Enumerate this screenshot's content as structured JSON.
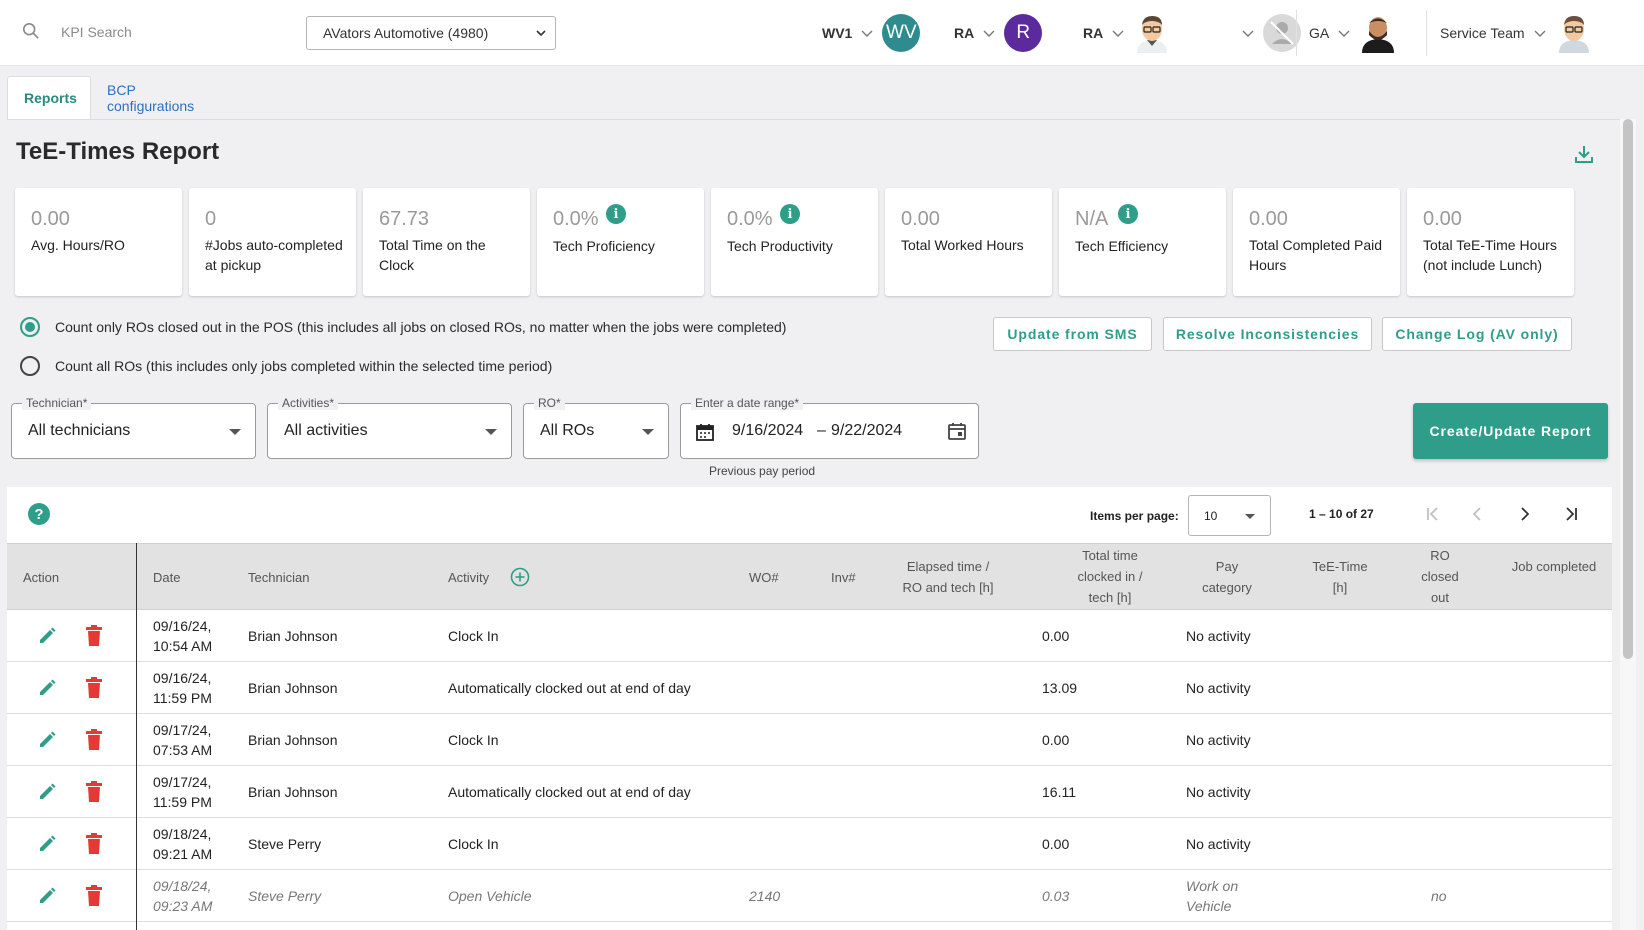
{
  "search": {
    "placeholder": "KPI Search"
  },
  "dealer": {
    "selected": "AVators Automotive (4980)"
  },
  "users": [
    {
      "label": "WV1",
      "avatar_text": "WV",
      "avatar_color": "#2e8c8f"
    },
    {
      "label": "RA",
      "avatar_text": "R",
      "avatar_color": "#5b2b9e"
    },
    {
      "label": "RA",
      "avatar_text": "",
      "avatar_icon": "person-avatar-glasses"
    },
    {
      "label": "",
      "avatar_icon": "no-signal-avatar"
    },
    {
      "label": "GA",
      "avatar_icon": "person-avatar-bearded"
    },
    {
      "label": "Service Team",
      "avatar_icon": "person-avatar-glasses"
    }
  ],
  "tabs": [
    "Reports",
    "BCP configurations"
  ],
  "report": {
    "title": "TeE-Times Report"
  },
  "kpis": [
    {
      "value": "0.00",
      "label": "Avg. Hours/RO"
    },
    {
      "value": "0",
      "label": "#Jobs auto-completed at pickup"
    },
    {
      "value": "67.73",
      "label": "Total Time on the Clock"
    },
    {
      "value": "0.0%",
      "label": "Tech Proficiency",
      "info": "i"
    },
    {
      "value": "0.0%",
      "label": "Tech Productivity",
      "info": "i"
    },
    {
      "value": "0.00",
      "label": "Total Worked Hours"
    },
    {
      "value": "N/A",
      "label": "Tech Efficiency",
      "info": "i"
    },
    {
      "value": "0.00",
      "label": "Total Completed Paid Hours"
    },
    {
      "value": "0.00",
      "label": "Total TeE-Time Hours (not include Lunch)"
    }
  ],
  "options": {
    "radio1": "Count only ROs closed out in the POS (this includes all jobs on closed ROs, no matter when the jobs were completed)",
    "radio2": "Count all ROs (this includes only jobs completed within the selected time period)",
    "selected": 1
  },
  "buttons": {
    "update_sms": "Update from SMS",
    "resolve": "Resolve Inconsistencies",
    "changelog": "Change Log (AV only)",
    "create": "Create/Update Report"
  },
  "filters": {
    "technician": {
      "label": "Technician*",
      "value": "All technicians"
    },
    "activities": {
      "label": "Activities*",
      "value": "All activities"
    },
    "ro": {
      "label": "RO*",
      "value": "All ROs"
    },
    "daterange": {
      "label": "Enter a date range*",
      "start": "9/16/2024",
      "sep": "–",
      "end": "9/22/2024",
      "hint": "Previous pay period"
    }
  },
  "pagination": {
    "items_label": "Items per page:",
    "items_value": "10",
    "range": "1 – 10 of 27"
  },
  "table": {
    "headers": {
      "action": "Action",
      "date": "Date",
      "technician": "Technician",
      "activity": "Activity",
      "wo": "WO#",
      "inv": "Inv#",
      "elapsed": "Elapsed time / RO and tech [h]",
      "total": "Total time clocked in / tech [h]",
      "pay": "Pay category",
      "tee": "TeE-Time [h]",
      "ro_closed": "RO closed out",
      "job_completed": "Job completed"
    },
    "rows": [
      {
        "date": "09/16/24, 10:54 AM",
        "tech": "Brian Johnson",
        "activity": "Clock In",
        "wo": "",
        "total": "0.00",
        "pay": "No activity",
        "ro_closed": "",
        "pending": false
      },
      {
        "date": "09/16/24, 11:59 PM",
        "tech": "Brian Johnson",
        "activity": "Automatically clocked out at end of day",
        "wo": "",
        "total": "13.09",
        "pay": "No activity",
        "ro_closed": "",
        "pending": false
      },
      {
        "date": "09/17/24, 07:53 AM",
        "tech": "Brian Johnson",
        "activity": "Clock In",
        "wo": "",
        "total": "0.00",
        "pay": "No activity",
        "ro_closed": "",
        "pending": false
      },
      {
        "date": "09/17/24, 11:59 PM",
        "tech": "Brian Johnson",
        "activity": "Automatically clocked out at end of day",
        "wo": "",
        "total": "16.11",
        "pay": "No activity",
        "ro_closed": "",
        "pending": false
      },
      {
        "date": "09/18/24, 09:21 AM",
        "tech": "Steve Perry",
        "activity": "Clock In",
        "wo": "",
        "total": "0.00",
        "pay": "No activity",
        "ro_closed": "",
        "pending": false
      },
      {
        "date": "09/18/24, 09:23 AM",
        "tech": "Steve Perry",
        "activity": "Open Vehicle",
        "wo": "2140",
        "total": "0.03",
        "pay": "Work on Vehicle",
        "ro_closed": "no",
        "pending": true
      }
    ]
  },
  "colors": {
    "accent": "#2e9e8a",
    "danger": "#e53935",
    "link": "#2b6fc2"
  }
}
